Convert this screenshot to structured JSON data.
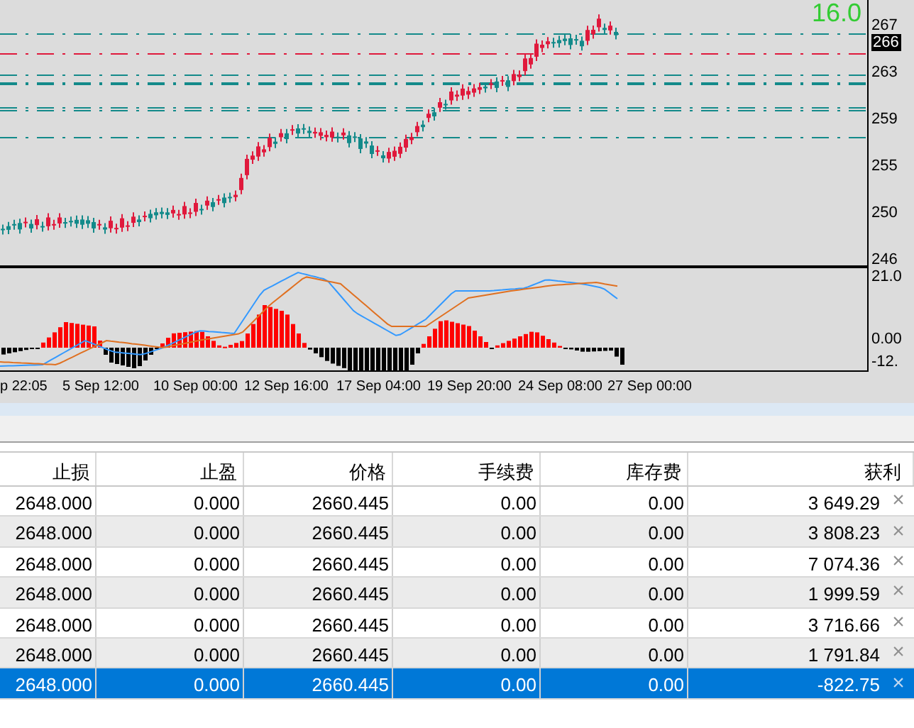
{
  "chart": {
    "spread_label": "16.0",
    "price_axis": [
      {
        "label": "267",
        "kind": "tick"
      },
      {
        "label": "266",
        "kind": "current"
      },
      {
        "label": "263",
        "kind": "tick"
      },
      {
        "label": "259",
        "kind": "tick"
      },
      {
        "label": "255",
        "kind": "tick"
      },
      {
        "label": "250",
        "kind": "tick"
      },
      {
        "label": "246",
        "kind": "tick"
      }
    ],
    "indicator_axis": [
      "21.0",
      "0.00",
      "-12."
    ],
    "time_axis": [
      "p 22:05",
      "5 Sep 12:00",
      "10 Sep 00:00",
      "12 Sep 16:00",
      "17 Sep 04:00",
      "19 Sep 20:00",
      "24 Sep 08:00",
      "27 Sep 00:00"
    ]
  },
  "table": {
    "columns": [
      "止损",
      "止盈",
      "价格",
      "手续费",
      "库存费",
      "获利"
    ],
    "rows": [
      {
        "cells": [
          "2648.000",
          "0.000",
          "2660.445",
          "0.00",
          "0.00",
          "3 649.29"
        ],
        "close": "×",
        "selected": false
      },
      {
        "cells": [
          "2648.000",
          "0.000",
          "2660.445",
          "0.00",
          "0.00",
          "3 808.23"
        ],
        "close": "×",
        "selected": false
      },
      {
        "cells": [
          "2648.000",
          "0.000",
          "2660.445",
          "0.00",
          "0.00",
          "7 074.36"
        ],
        "close": "×",
        "selected": false
      },
      {
        "cells": [
          "2648.000",
          "0.000",
          "2660.445",
          "0.00",
          "0.00",
          "1 999.59"
        ],
        "close": "×",
        "selected": false
      },
      {
        "cells": [
          "2648.000",
          "0.000",
          "2660.445",
          "0.00",
          "0.00",
          "3 716.66"
        ],
        "close": "×",
        "selected": false
      },
      {
        "cells": [
          "2648.000",
          "0.000",
          "2660.445",
          "0.00",
          "0.00",
          "1 791.84"
        ],
        "close": "×",
        "selected": false
      },
      {
        "cells": [
          "2648.000",
          "0.000",
          "2660.445",
          "0.00",
          "0.00",
          "-822.75"
        ],
        "close": "×",
        "selected": true
      }
    ]
  }
}
